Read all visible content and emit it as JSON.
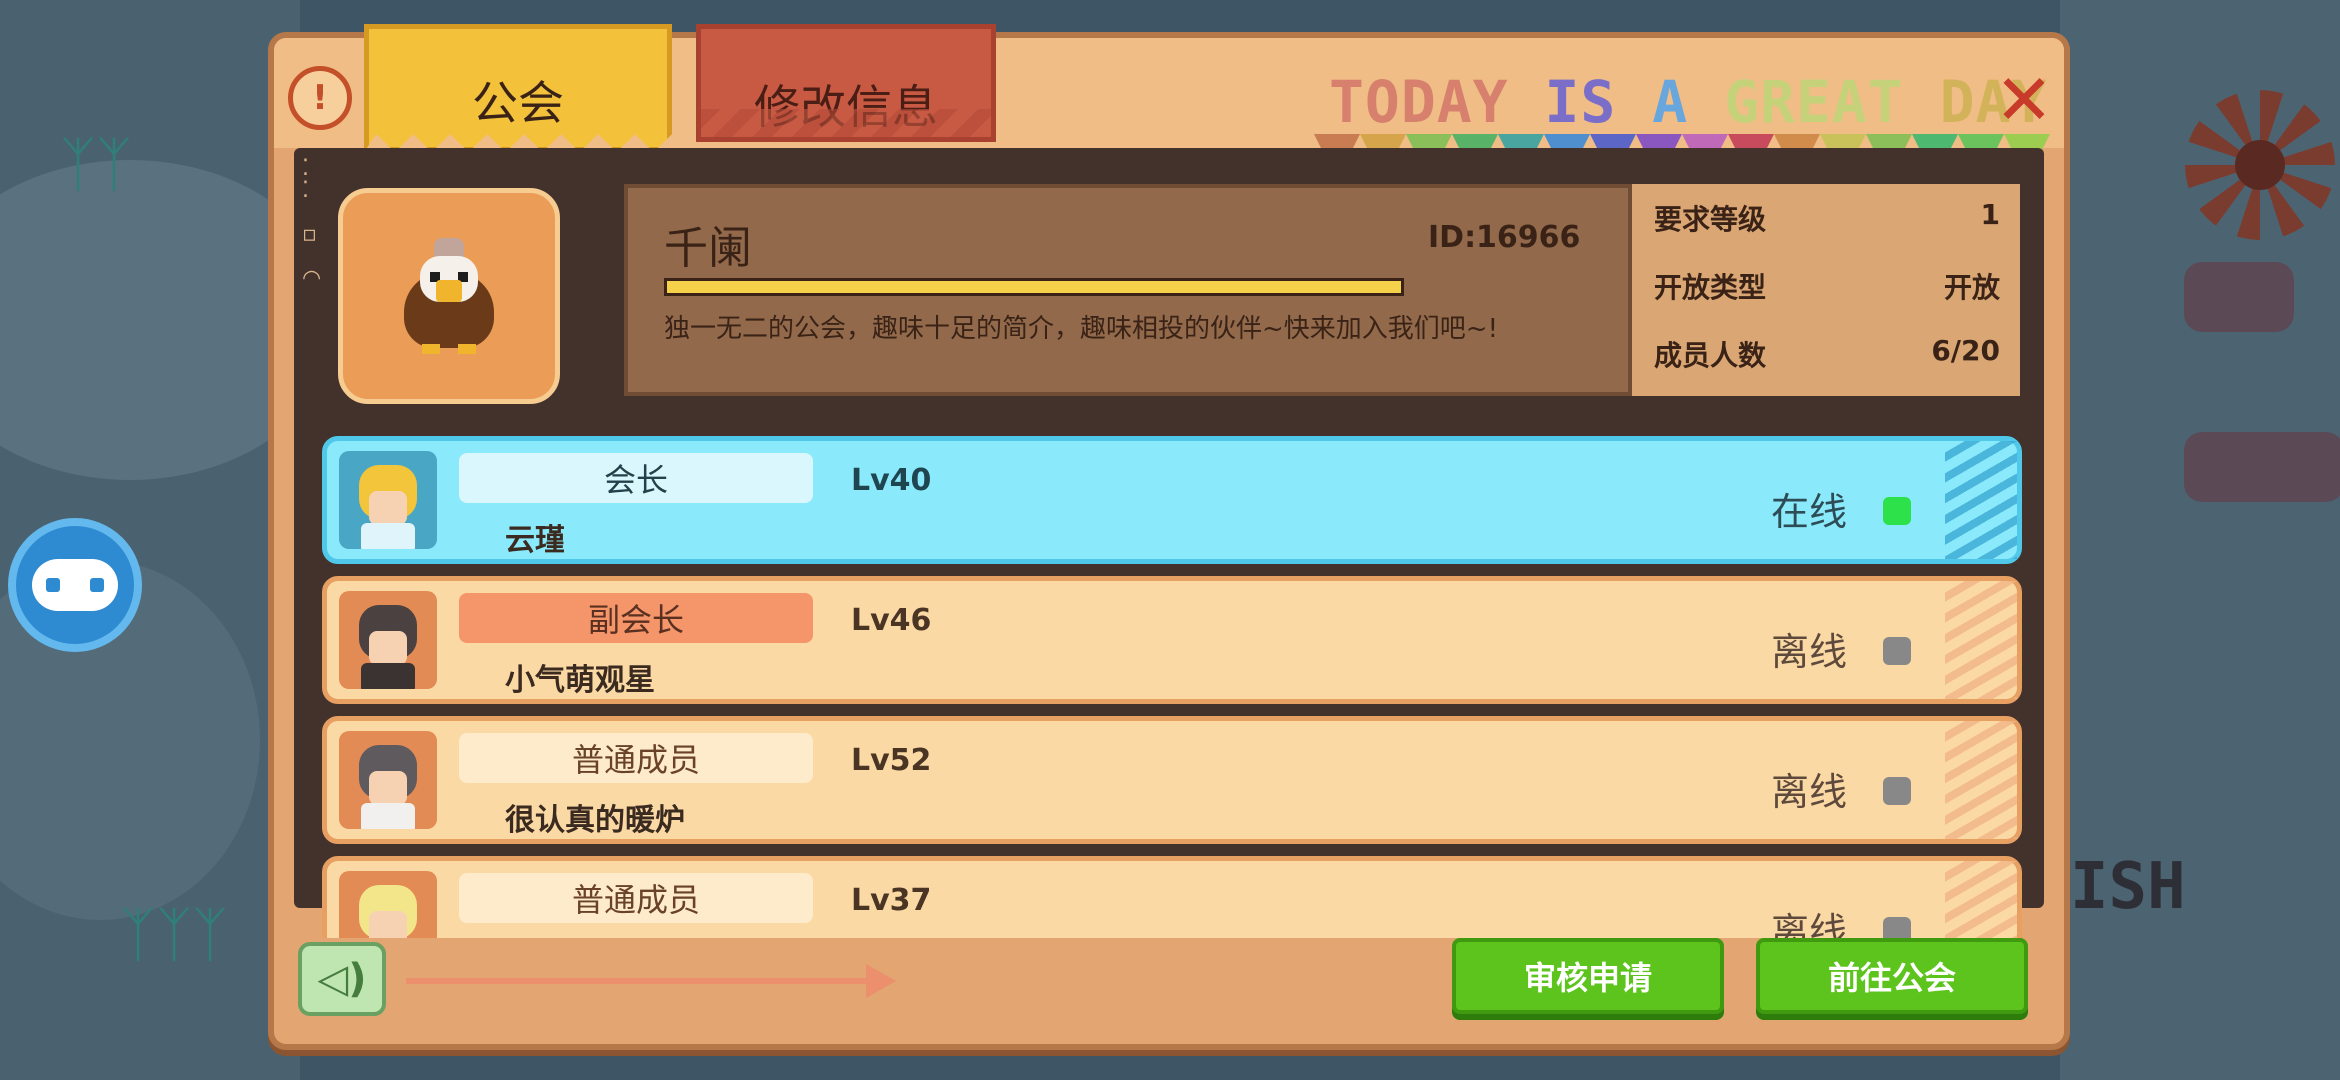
{
  "tabs": [
    {
      "label": "公会",
      "active": true
    },
    {
      "label": "修改信息",
      "active": false
    }
  ],
  "banner": {
    "parts": [
      "TODAY ",
      "IS ",
      "A ",
      "GREAT ",
      "DAY"
    ],
    "flag_colors": [
      "#c97b52",
      "#d6a44a",
      "#8bbf5a",
      "#58b268",
      "#49a5a0",
      "#4f8fd0",
      "#5c66c7",
      "#8a57c1",
      "#c069b8",
      "#c84a5d",
      "#d18b4a",
      "#c9c25a",
      "#8cbf5a",
      "#4db86f",
      "#6ac35c",
      "#9ccc50"
    ]
  },
  "guild": {
    "name": "千阑",
    "id_text": "ID:16966",
    "exp_percent": 100,
    "description": "独一无二的公会，趣味十足的简介，趣味相投的伙伴~快来加入我们吧~!",
    "stats": [
      {
        "label": "要求等级",
        "value": "1"
      },
      {
        "label": "开放类型",
        "value": "开放"
      },
      {
        "label": "成员人数",
        "value": "6/20"
      }
    ]
  },
  "members": [
    {
      "role": "会长",
      "name": "云瑾",
      "level": "Lv40",
      "status": "在线",
      "type": "leader",
      "online": true
    },
    {
      "role": "副会长",
      "name": "小气萌观星",
      "level": "Lv46",
      "status": "离线",
      "type": "vice",
      "online": false
    },
    {
      "role": "普通成员",
      "name": "很认真的暖炉",
      "level": "Lv52",
      "status": "离线",
      "type": "normal",
      "online": false
    },
    {
      "role": "普通成员",
      "name": "",
      "level": "Lv37",
      "status": "离线",
      "type": "normal",
      "online": false
    }
  ],
  "footer": {
    "review_label": "审核申请",
    "goto_label": "前往公会"
  },
  "colors": {
    "online": "#2de14a",
    "offline": "#888888",
    "button_green": "#5dc41d",
    "tab_active": "#f3c23a",
    "tab_inactive": "#c85a44"
  },
  "icons": [
    "info-icon",
    "close-icon",
    "gamepad-icon",
    "voice-icon",
    "guild-emblem-chicken-icon"
  ]
}
